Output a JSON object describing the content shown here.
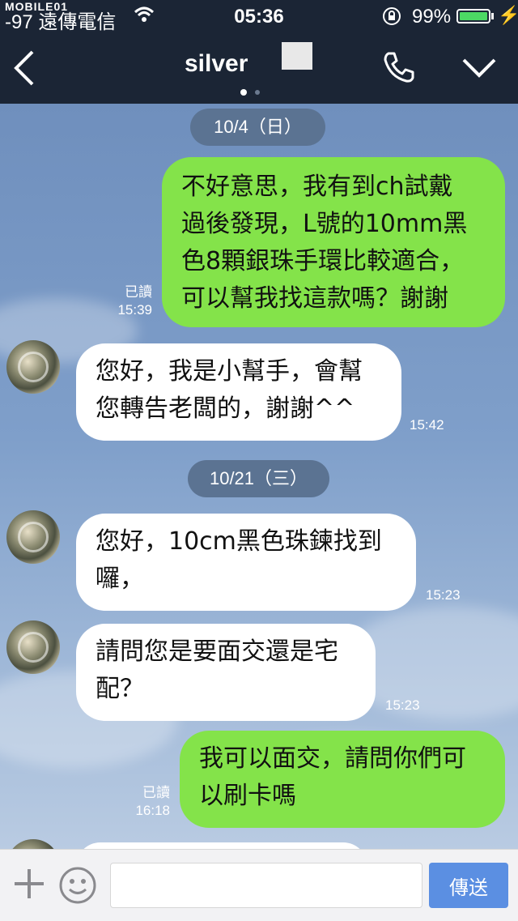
{
  "status_bar": {
    "watermark": "MOBILE01",
    "carrier": "-97 遠傳電信",
    "time": "05:36",
    "battery": "99%",
    "battery_level": 0.99
  },
  "header": {
    "title": "silver",
    "icons": {
      "back": "chevron-left-icon",
      "call": "phone-icon",
      "menu": "chevron-down-icon"
    }
  },
  "messages": [
    {
      "type": "date",
      "text": "10/4（日）"
    },
    {
      "type": "msg",
      "side": "me",
      "lines": [
        "不好意思，我有到ch試戴",
        "過後發現，L號的10mm黑",
        "色8顆銀珠手環比較適合，",
        "可以幫我找這款嗎？謝謝"
      ],
      "read": "已讀",
      "time": "15:39"
    },
    {
      "type": "msg",
      "side": "them",
      "lines": [
        "您好，我是小幫手，會幫",
        "您轉告老闆的，謝謝^^"
      ],
      "time": "15:42"
    },
    {
      "type": "date",
      "text": "10/21（三）"
    },
    {
      "type": "msg",
      "side": "them",
      "lines": [
        "您好，10cm黑色珠鍊找到",
        "囉，"
      ],
      "time": "15:23"
    },
    {
      "type": "msg",
      "side": "them",
      "lines": [
        "請問您是要面交還是宅",
        "配？"
      ],
      "time": "15:23"
    },
    {
      "type": "msg",
      "side": "me",
      "lines": [
        "我可以面交，請問你們可",
        "以刷卡嗎"
      ],
      "read": "已讀",
      "time": "16:18"
    }
  ],
  "input_bar": {
    "placeholder": "",
    "send_label": "傳送",
    "icons": {
      "plus": "plus-icon",
      "emoji": "emoji-icon"
    }
  },
  "colors": {
    "my_bubble": "#84e34a",
    "their_bubble": "#ffffff",
    "header_bg": "#1b2535",
    "send_button": "#5b8fe2"
  }
}
